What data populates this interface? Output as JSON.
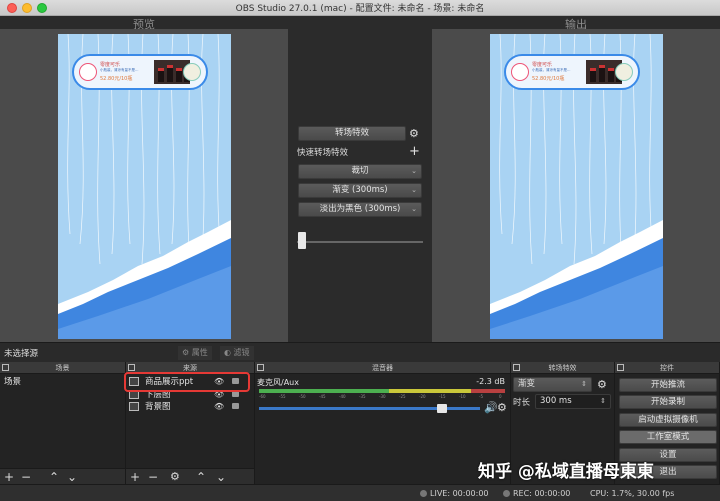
{
  "window": {
    "title": "OBS Studio 27.0.1 (mac) - 配置文件: 未命名 - 场景: 未命名"
  },
  "preview": {
    "label": "预览",
    "ticker": {
      "brand": "零度可乐",
      "desc": "小瓶装，清凉有量不是…",
      "price": "52.80元/10瓶"
    }
  },
  "program": {
    "label": "输出",
    "ticker": {
      "brand": "零度可乐",
      "desc": "小瓶装，清凉有量不是…",
      "price": "52.80元/10瓶"
    }
  },
  "transitions": {
    "transition_button": "转场特效",
    "quick_label": "快速转场特效",
    "items": [
      "裁切",
      "渐变 (300ms)",
      "淡出为黑色 (300ms)"
    ]
  },
  "source_bar": {
    "no_source": "未选择源",
    "properties": "属性",
    "filters": "滤镜"
  },
  "scenes": {
    "title": "场景",
    "items": [
      "场景"
    ]
  },
  "sources": {
    "title": "来源",
    "items": [
      "商品展示ppt",
      "下层图",
      "背景图"
    ]
  },
  "mixer": {
    "title": "混音器",
    "channel": "麦克风/Aux",
    "db": "-2.3 dB",
    "ticks": [
      "-60",
      "-55",
      "-50",
      "-45",
      "-40",
      "-35",
      "-30",
      "-25",
      "-20",
      "-15",
      "-10",
      "-5",
      "0"
    ],
    "level_green": 0.53,
    "level_yellow": 0.33,
    "level_red": 0.14,
    "volume": 0.83
  },
  "scene_transitions": {
    "title": "转场特效",
    "type": "渐变",
    "duration_label": "时长",
    "duration": "300 ms"
  },
  "controls": {
    "title": "控件",
    "buttons": [
      "开始推流",
      "开始录制",
      "启动虚拟摄像机",
      "工作室模式",
      "设置",
      "退出"
    ]
  },
  "status": {
    "live": "LIVE: 00:00:00",
    "rec": "REC: 00:00:00",
    "cpu": "CPU: 1.7%, 30.00 fps"
  },
  "watermark": "知乎 @私域直播母東東"
}
